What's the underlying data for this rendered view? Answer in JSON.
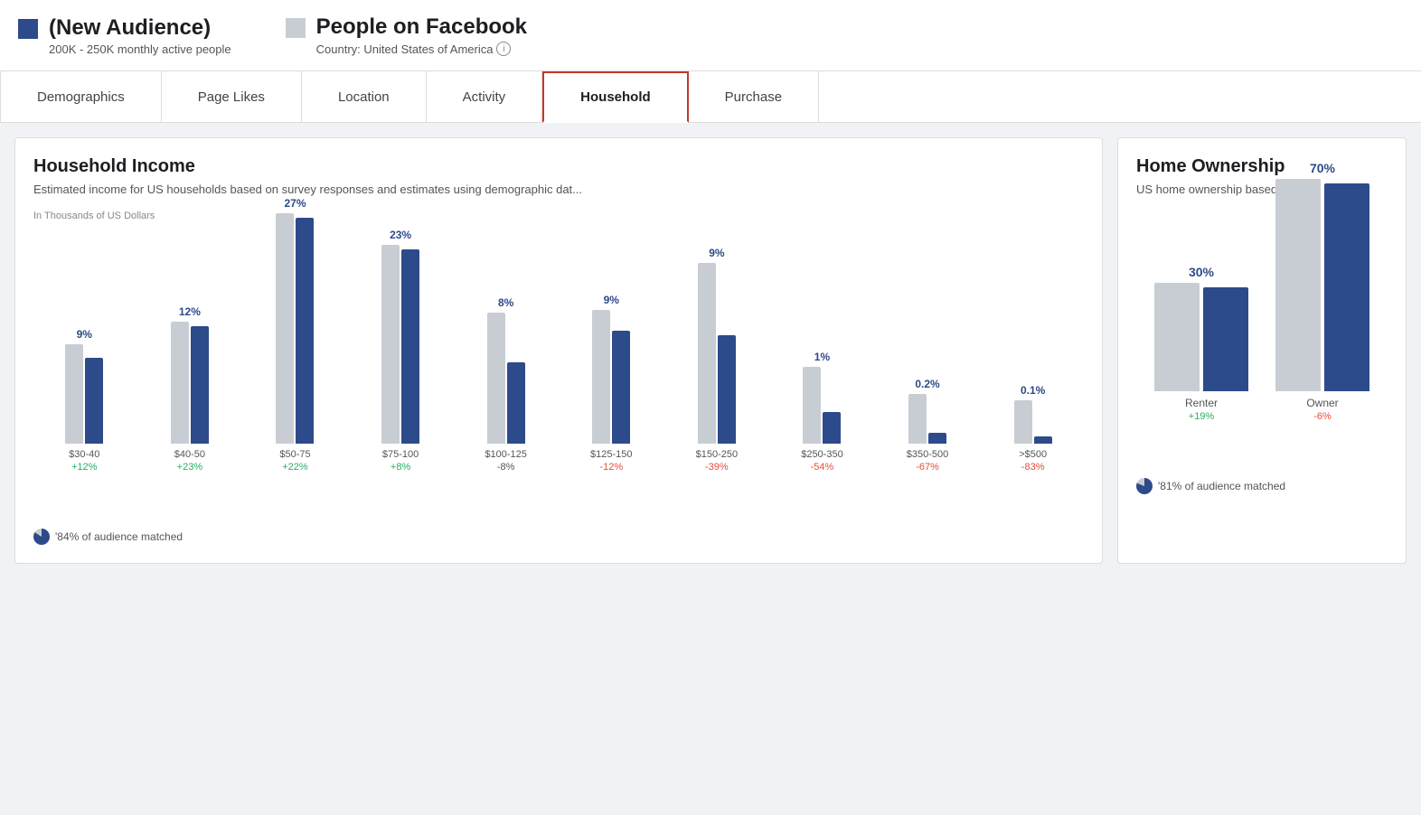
{
  "header": {
    "audience": {
      "color": "#2d4a8a",
      "title": "(New Audience)",
      "subtitle": "200K - 250K monthly active people"
    },
    "facebook": {
      "color": "#c8cdd4",
      "title": "People on Facebook",
      "subtitle": "Country: United States of America",
      "info": "i"
    }
  },
  "tabs": [
    {
      "label": "Demographics",
      "active": false
    },
    {
      "label": "Page Likes",
      "active": false
    },
    {
      "label": "Location",
      "active": false
    },
    {
      "label": "Activity",
      "active": false
    },
    {
      "label": "Household",
      "active": true
    },
    {
      "label": "Purchase",
      "active": false
    }
  ],
  "household_income": {
    "title": "Household Income",
    "subtitle": "Estimated income for US households based on survey responses and estimates using demographic dat...",
    "axis_label": "In Thousands of US Dollars",
    "footer": "'84% of audience matched",
    "bars": [
      {
        "range": "$30-40",
        "pct": "9%",
        "diff": "+12%",
        "diff_type": "pos",
        "bg_h": 110,
        "fg_h": 95
      },
      {
        "range": "$40-50",
        "pct": "12%",
        "diff": "+23%",
        "diff_type": "pos",
        "bg_h": 135,
        "fg_h": 130
      },
      {
        "range": "$50-75",
        "pct": "27%",
        "diff": "+22%",
        "diff_type": "pos",
        "bg_h": 255,
        "fg_h": 250
      },
      {
        "range": "$75-100",
        "pct": "23%",
        "diff": "+8%",
        "diff_type": "pos",
        "bg_h": 220,
        "fg_h": 215
      },
      {
        "range": "$100-125",
        "pct": "8%",
        "diff": "-8%",
        "diff_type": "neu",
        "bg_h": 145,
        "fg_h": 90
      },
      {
        "range": "$125-150",
        "pct": "9%",
        "diff": "-12%",
        "diff_type": "neg",
        "bg_h": 148,
        "fg_h": 125
      },
      {
        "range": "$150-250",
        "pct": "9%",
        "diff": "-39%",
        "diff_type": "neg",
        "bg_h": 200,
        "fg_h": 120
      },
      {
        "range": "$250-350",
        "pct": "1%",
        "diff": "-54%",
        "diff_type": "neg",
        "bg_h": 85,
        "fg_h": 35
      },
      {
        "range": "$350-500",
        "pct": "0.2%",
        "diff": "-67%",
        "diff_type": "neg",
        "bg_h": 55,
        "fg_h": 12
      },
      {
        "range": ">$500",
        "pct": "0.1%",
        "diff": "-83%",
        "diff_type": "neg",
        "bg_h": 48,
        "fg_h": 8
      }
    ]
  },
  "home_ownership": {
    "title": "Home Ownership",
    "subtitle": "US home ownership based on...",
    "footer": "'81% of audience matched",
    "bars": [
      {
        "range": "Renter",
        "pct": "30%",
        "diff": "+19%",
        "diff_type": "pos",
        "bg_h": 120,
        "fg_h": 115
      },
      {
        "range": "Owner",
        "pct": "70%",
        "diff": "-6%",
        "diff_type": "neg",
        "bg_h": 235,
        "fg_h": 230
      }
    ]
  }
}
